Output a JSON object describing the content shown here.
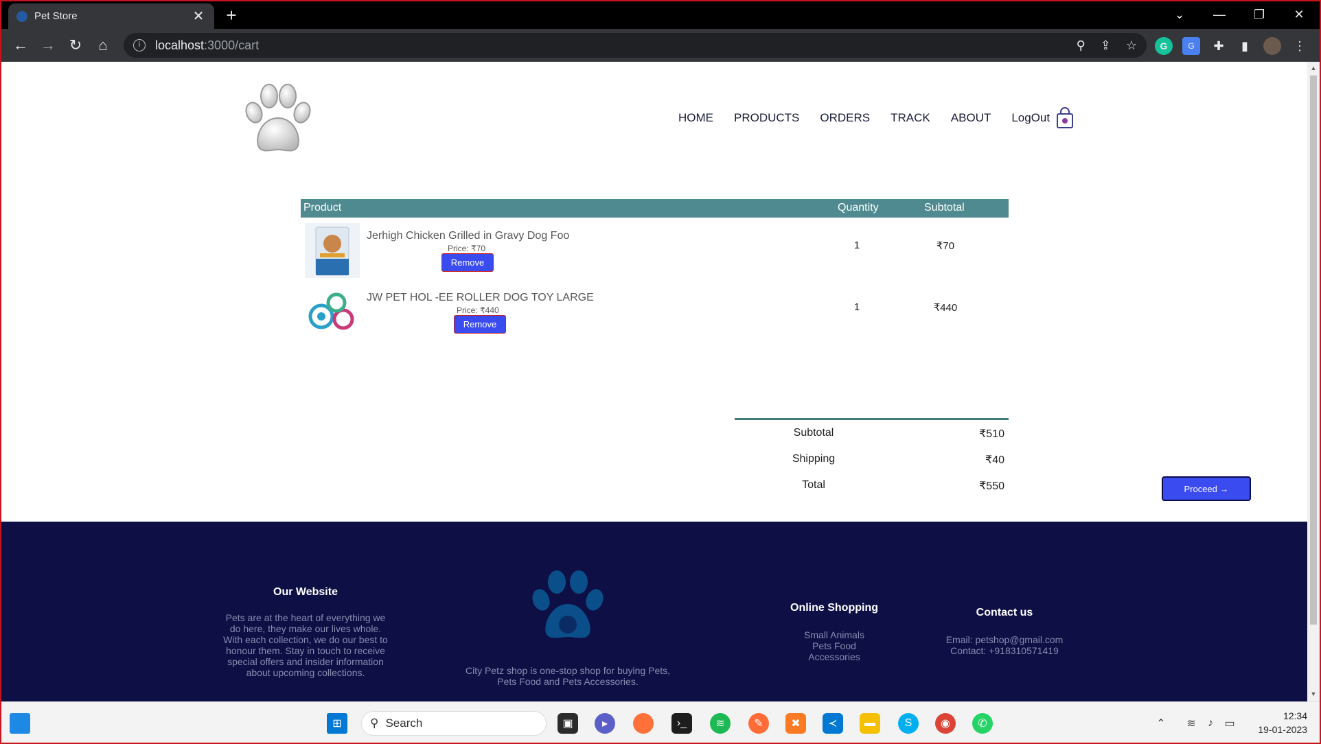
{
  "browser": {
    "tab_title": "Pet Store",
    "tab_close": "✕",
    "new_tab": "+",
    "url_host": "localhost",
    "url_path": ":3000/cart"
  },
  "nav": {
    "items": [
      "HOME",
      "PRODUCTS",
      "ORDERS",
      "TRACK",
      "ABOUT",
      "LogOut"
    ]
  },
  "cart": {
    "headers": {
      "product": "Product",
      "quantity": "Quantity",
      "subtotal": "Subtotal"
    },
    "items": [
      {
        "name": "Jerhigh Chicken Grilled in Gravy Dog Foo",
        "price": "Price: ₹70",
        "remove": "Remove",
        "quantity": "1",
        "subtotal": "₹70"
      },
      {
        "name": "JW PET HOL -EE ROLLER DOG TOY LARGE",
        "price": "Price: ₹440",
        "remove": "Remove",
        "quantity": "1",
        "subtotal": "₹440"
      }
    ],
    "totals": [
      {
        "label": "Subtotal",
        "value": "₹510"
      },
      {
        "label": "Shipping",
        "value": "₹40"
      },
      {
        "label": "Total",
        "value": "₹550"
      }
    ],
    "proceed": "Proceed →"
  },
  "footer": {
    "website_title": "Our Website",
    "website_text": "Pets are at the heart of everything we do here, they make our lives whole. With each collection, we do our best to honour them. Stay in touch to receive special offers and insider information about upcoming collections.",
    "center_text": "City Petz shop is one-stop shop for buying Pets, Pets Food and Pets Accessories.",
    "shopping_title": "Online Shopping",
    "shopping_items": [
      "Small Animals",
      "Pets Food",
      "Accessories"
    ],
    "contact_title": "Contact us",
    "contact_email": "Email: petshop@gmail.com",
    "contact_phone": "Contact: +918310571419"
  },
  "taskbar": {
    "search": "Search",
    "time": "12:34",
    "date": "19-01-2023"
  },
  "colors": {
    "header_bar": "#4f8a90",
    "button": "#3a4bf0",
    "footer_bg": "#0d0f45"
  }
}
